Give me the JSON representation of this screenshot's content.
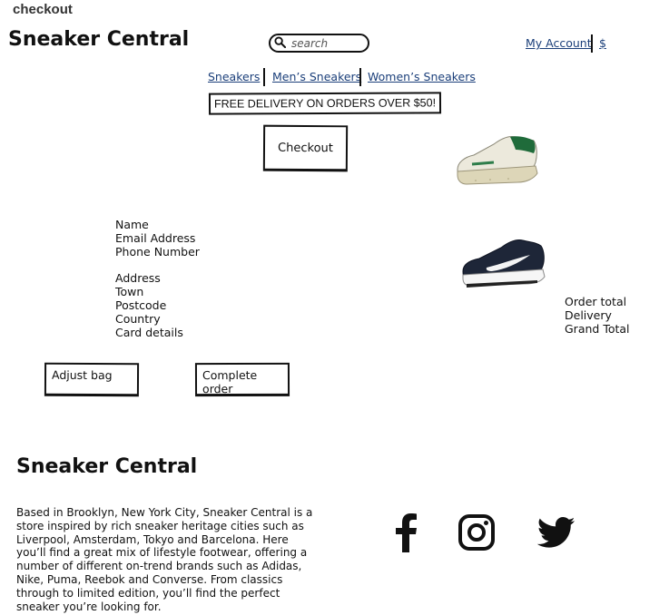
{
  "page_label": "checkout",
  "header": {
    "brand": "Sneaker Central",
    "search_placeholder": "search",
    "my_account": "My Account",
    "currency": "$"
  },
  "nav": {
    "items": [
      {
        "label": "Sneakers"
      },
      {
        "label": "Men’s Sneakers"
      },
      {
        "label": "Women’s Sneakers"
      }
    ]
  },
  "banner": "FREE DELIVERY ON ORDERS OVER $50!",
  "checkout_button": "Checkout",
  "form_fields": {
    "name": "Name",
    "email": "Email Address",
    "phone": "Phone Number",
    "address": "Address",
    "town": "Town",
    "postcode": "Postcode",
    "country": "Country",
    "card": "Card details"
  },
  "totals": {
    "order_total": "Order total",
    "delivery": "Delivery",
    "grand_total": "Grand Total"
  },
  "buttons": {
    "adjust_bag": "Adjust bag",
    "complete_order": "Complete order"
  },
  "products": [
    {
      "icon": "sneaker-white-green-icon"
    },
    {
      "icon": "sneaker-navy-white-icon"
    }
  ],
  "footer": {
    "brand": "Sneaker Central",
    "about": "Based in Brooklyn, New York City, Sneaker Central is a store inspired by rich sneaker heritage cities such as Liverpool, Amsterdam, Tokyo and Barcelona. Here you’ll find a great mix of lifestyle footwear, offering a number of different on-trend brands such as Adidas, Nike, Puma, Reebok and Converse. From classics through to limited edition, you’ll find the perfect sneaker you’re looking for.",
    "social": [
      "facebook-icon",
      "instagram-icon",
      "twitter-icon"
    ]
  },
  "colors": {
    "link": "#1b3f7a",
    "border": "#111111"
  }
}
